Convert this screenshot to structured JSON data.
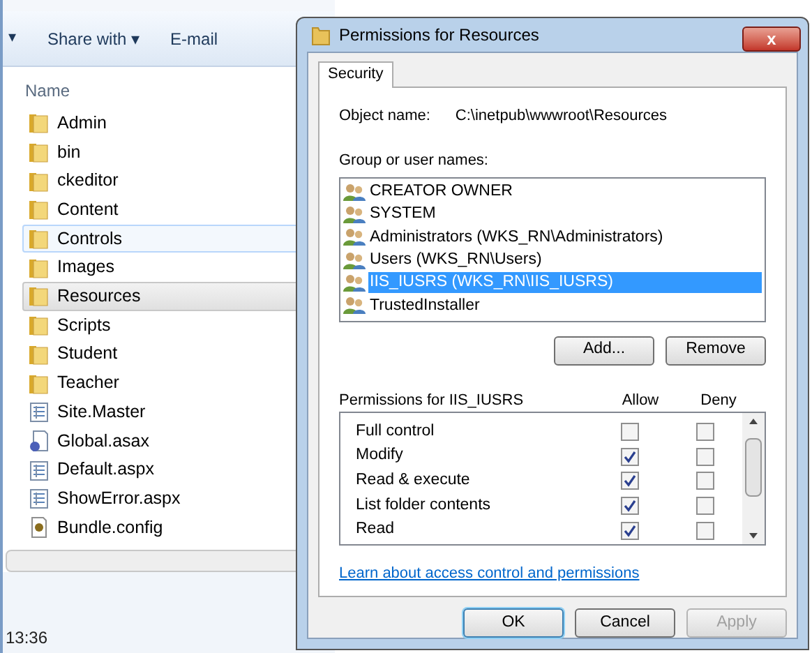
{
  "explorer": {
    "toolbar": [
      {
        "kind": "dropdown-stub",
        "label": "▾"
      },
      {
        "kind": "menu",
        "label": "Share with",
        "caret": "▾"
      },
      {
        "kind": "button",
        "label": "E-mail"
      }
    ],
    "column_header": "Name",
    "files": [
      {
        "name": "Admin",
        "kind": "folder",
        "selected": false,
        "hovered": false
      },
      {
        "name": "bin",
        "kind": "folder",
        "selected": false,
        "hovered": false
      },
      {
        "name": "ckeditor",
        "kind": "folder",
        "selected": false,
        "hovered": false
      },
      {
        "name": "Content",
        "kind": "folder",
        "selected": false,
        "hovered": false
      },
      {
        "name": "Controls",
        "kind": "folder",
        "selected": false,
        "hovered": true
      },
      {
        "name": "Images",
        "kind": "folder",
        "selected": false,
        "hovered": false
      },
      {
        "name": "Resources",
        "kind": "folder",
        "selected": true,
        "hovered": false
      },
      {
        "name": "Scripts",
        "kind": "folder",
        "selected": false,
        "hovered": false
      },
      {
        "name": "Student",
        "kind": "folder",
        "selected": false,
        "hovered": false
      },
      {
        "name": "Teacher",
        "kind": "folder",
        "selected": false,
        "hovered": false
      },
      {
        "name": "Site.Master",
        "kind": "page",
        "selected": false,
        "hovered": false
      },
      {
        "name": "Global.asax",
        "kind": "app",
        "selected": false,
        "hovered": false
      },
      {
        "name": "Default.aspx",
        "kind": "page",
        "selected": false,
        "hovered": false
      },
      {
        "name": "ShowError.aspx",
        "kind": "page",
        "selected": false,
        "hovered": false
      },
      {
        "name": "Bundle.config",
        "kind": "config",
        "selected": false,
        "hovered": false
      }
    ],
    "status": "13:36"
  },
  "dialog": {
    "title": "Permissions for Resources",
    "close": "x",
    "tabs": [
      {
        "label": "Security",
        "selected": true
      }
    ],
    "object_name_label": "Object name:",
    "object_name": "C:\\inetpub\\wwwroot\\Resources",
    "group_label": "Group or user names:",
    "users": [
      {
        "name": "CREATOR OWNER",
        "selected": false
      },
      {
        "name": "SYSTEM",
        "selected": false
      },
      {
        "name": "Administrators (WKS_RN\\Administrators)",
        "selected": false
      },
      {
        "name": "Users (WKS_RN\\Users)",
        "selected": false
      },
      {
        "name": "IIS_IUSRS (WKS_RN\\IIS_IUSRS)",
        "selected": true
      },
      {
        "name": "TrustedInstaller",
        "selected": false
      }
    ],
    "user_buttons": [
      "Add...",
      "Remove"
    ],
    "permissions_label": "Permissions for IIS_IUSRS",
    "allow_label": "Allow",
    "deny_label": "Deny",
    "permissions": [
      {
        "name": "Full control",
        "allow": false,
        "deny": false
      },
      {
        "name": "Modify",
        "allow": true,
        "deny": false
      },
      {
        "name": "Read & execute",
        "allow": true,
        "deny": false
      },
      {
        "name": "List folder contents",
        "allow": true,
        "deny": false
      },
      {
        "name": "Read",
        "allow": true,
        "deny": false
      }
    ],
    "link": "Learn about access control and permissions",
    "buttons": [
      {
        "label": "OK",
        "default": true,
        "disabled": false
      },
      {
        "label": "Cancel",
        "default": false,
        "disabled": false
      },
      {
        "label": "Apply",
        "default": false,
        "disabled": true
      }
    ]
  }
}
